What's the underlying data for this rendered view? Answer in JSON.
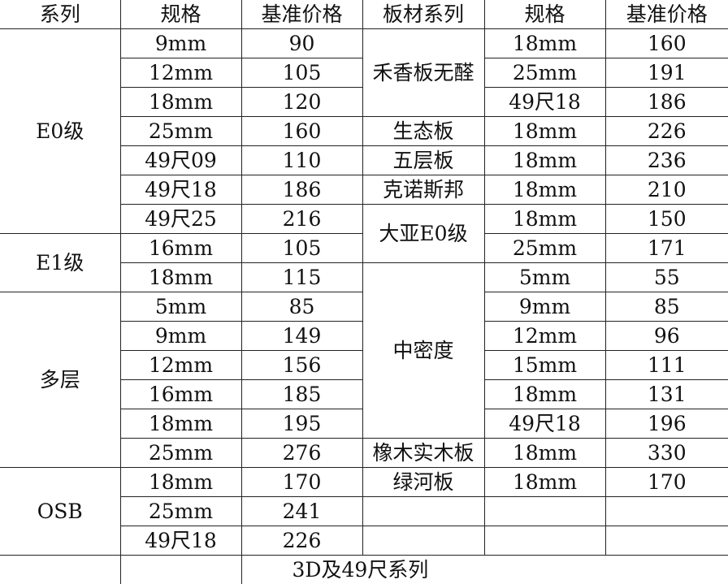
{
  "headers": [
    "系列",
    "规格",
    "基准价格",
    "板材系列",
    "规格",
    "基准价格"
  ],
  "left": {
    "groups": [
      {
        "name": "E0级",
        "rows": [
          [
            "9mm",
            "90"
          ],
          [
            "12mm",
            "105"
          ],
          [
            "18mm",
            "120"
          ],
          [
            "25mm",
            "160"
          ],
          [
            "49尺09",
            "110"
          ],
          [
            "49尺18",
            "186"
          ],
          [
            "49尺25",
            "216"
          ]
        ]
      },
      {
        "name": "E1级",
        "rows": [
          [
            "16mm",
            "105"
          ],
          [
            "18mm",
            "115"
          ]
        ]
      },
      {
        "name": "多层",
        "rows": [
          [
            "5mm",
            "85"
          ],
          [
            "9mm",
            "149"
          ],
          [
            "12mm",
            "156"
          ],
          [
            "16mm",
            "185"
          ],
          [
            "18mm",
            "195"
          ],
          [
            "25mm",
            "276"
          ]
        ]
      },
      {
        "name": "OSB",
        "rows": [
          [
            "18mm",
            "170"
          ],
          [
            "25mm",
            "241"
          ],
          [
            "49尺18",
            "226"
          ]
        ]
      }
    ]
  },
  "right": {
    "groups": [
      {
        "name": "禾香板无醛",
        "rows": [
          [
            "18mm",
            "160"
          ],
          [
            "25mm",
            "191"
          ],
          [
            "49尺18",
            "186"
          ]
        ]
      },
      {
        "name": "生态板",
        "rows": [
          [
            "18mm",
            "226"
          ]
        ]
      },
      {
        "name": "五层板",
        "rows": [
          [
            "18mm",
            "236"
          ]
        ]
      },
      {
        "name": "克诺斯邦",
        "rows": [
          [
            "18mm",
            "210"
          ]
        ]
      },
      {
        "name": "大亚E0级",
        "rows": [
          [
            "18mm",
            "150"
          ],
          [
            "25mm",
            "171"
          ]
        ]
      },
      {
        "name": "中密度",
        "rows": [
          [
            "5mm",
            "55"
          ],
          [
            "9mm",
            "85"
          ],
          [
            "12mm",
            "96"
          ],
          [
            "15mm",
            "111"
          ],
          [
            "18mm",
            "131"
          ],
          [
            "49尺18",
            "196"
          ]
        ]
      },
      {
        "name": "橡木实木板",
        "rows": [
          [
            "18mm",
            "330"
          ]
        ]
      },
      {
        "name": "绿河板",
        "rows": [
          [
            "18mm",
            "170"
          ]
        ]
      }
    ]
  },
  "footer": "3D及49尺系列"
}
